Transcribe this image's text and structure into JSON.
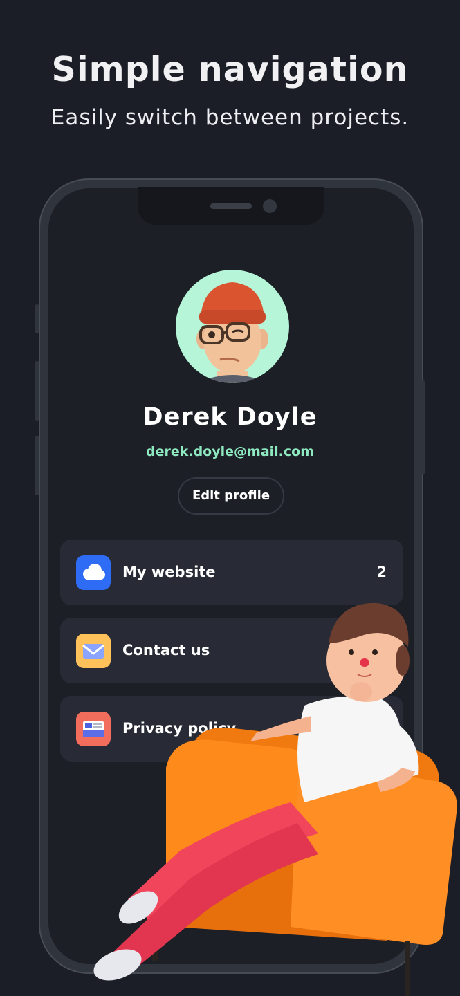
{
  "header": {
    "title": "Simple navigation",
    "subtitle": "Easily switch between projects."
  },
  "profile": {
    "name": "Derek Doyle",
    "email": "derek.doyle@mail.com",
    "edit_label": "Edit profile",
    "avatar_bg": "#b6f5d8"
  },
  "menu": {
    "items": [
      {
        "label": "My website",
        "icon": "cloud-icon",
        "icon_bg": "#2f6cf5",
        "count": "2"
      },
      {
        "label": "Contact us",
        "icon": "envelope-icon",
        "icon_bg": "#ffc25a"
      },
      {
        "label": "Privacy policy",
        "icon": "newspaper-icon",
        "icon_bg": "#f26d5b"
      }
    ]
  },
  "colors": {
    "background": "#1b1e26",
    "card": "#282b35",
    "accent": "#8ee8c0"
  }
}
